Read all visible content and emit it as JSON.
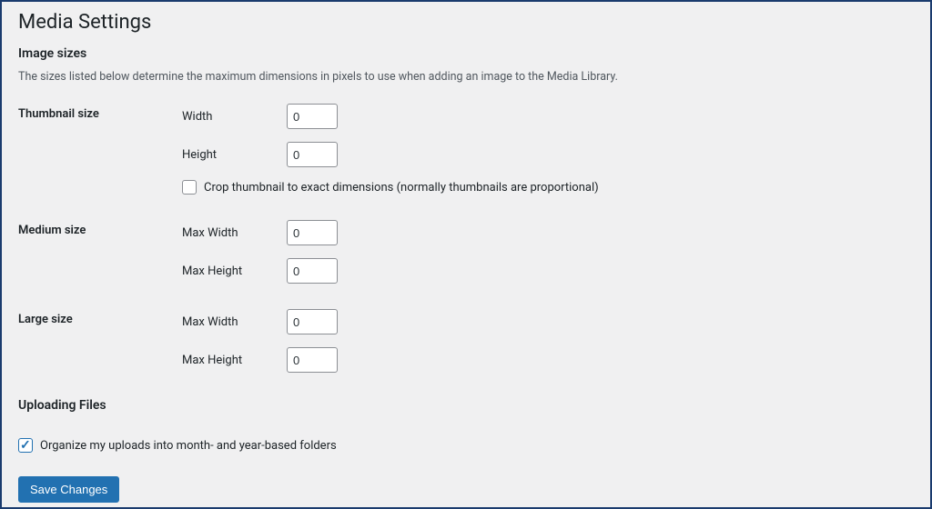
{
  "page_title": "Media Settings",
  "image_sizes": {
    "heading": "Image sizes",
    "description": "The sizes listed below determine the maximum dimensions in pixels to use when adding an image to the Media Library.",
    "thumbnail": {
      "label": "Thumbnail size",
      "width_label": "Width",
      "width_value": "0",
      "height_label": "Height",
      "height_value": "0",
      "crop_label": "Crop thumbnail to exact dimensions (normally thumbnails are proportional)",
      "crop_checked": false
    },
    "medium": {
      "label": "Medium size",
      "max_width_label": "Max Width",
      "max_width_value": "0",
      "max_height_label": "Max Height",
      "max_height_value": "0"
    },
    "large": {
      "label": "Large size",
      "max_width_label": "Max Width",
      "max_width_value": "0",
      "max_height_label": "Max Height",
      "max_height_value": "0"
    }
  },
  "uploading_files": {
    "heading": "Uploading Files",
    "organize_label": "Organize my uploads into month- and year-based folders",
    "organize_checked": true
  },
  "save_button_label": "Save Changes"
}
